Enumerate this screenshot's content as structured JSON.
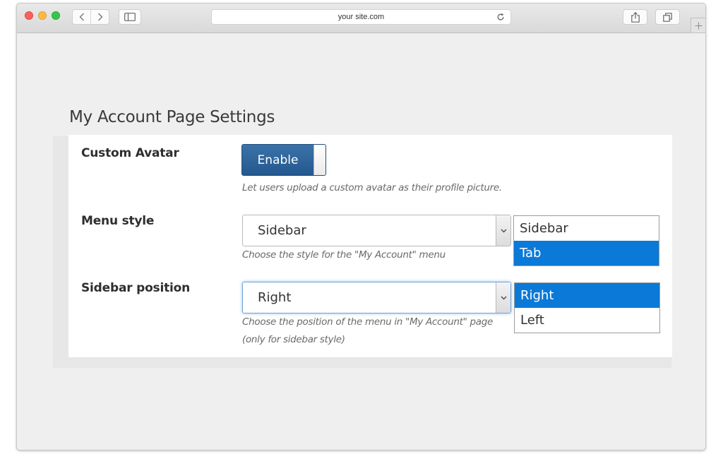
{
  "browser": {
    "url": "your site.com"
  },
  "page": {
    "title": "My Account Page Settings"
  },
  "settings": {
    "custom_avatar": {
      "label": "Custom Avatar",
      "toggle_label": "Enable",
      "hint": "Let users upload a custom avatar as their profile picture."
    },
    "menu_style": {
      "label": "Menu style",
      "value": "Sidebar",
      "hint": "Choose the style for the \"My Account\" menu",
      "options": [
        "Sidebar",
        "Tab"
      ],
      "highlighted": "Tab"
    },
    "sidebar_position": {
      "label": "Sidebar position",
      "value": "Right",
      "hint_line1": "Choose the position of the menu in \"My Account\" page",
      "hint_line2": "(only for sidebar style)",
      "options": [
        "Right",
        "Left"
      ],
      "highlighted": "Right"
    }
  },
  "colors": {
    "toggle_blue": "#2a5f95",
    "highlight_blue": "#0a79d8"
  }
}
